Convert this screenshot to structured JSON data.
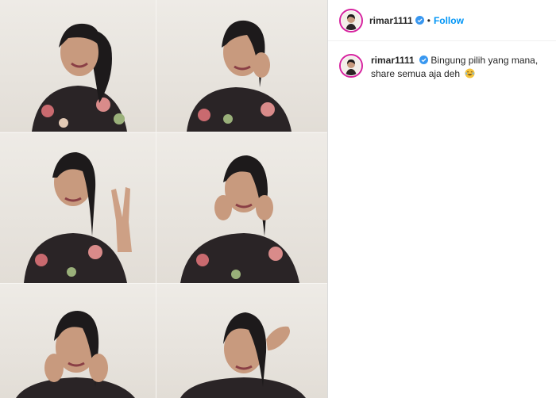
{
  "post": {
    "username": "rimar1111",
    "separator": "•",
    "follow_label": "Follow",
    "caption_line1": "Bingung pilih yang mana,",
    "caption_line2": "share semua aja deh",
    "caption_emoji": "laughing-tears-emoji"
  },
  "colors": {
    "follow": "#0095f6",
    "verified": "#3897f0",
    "avatar_ring": "#d6249f"
  },
  "photos": [
    {
      "name": "photo-wink-smile"
    },
    {
      "name": "photo-hand-on-cheek-wink"
    },
    {
      "name": "photo-peace-sign"
    },
    {
      "name": "photo-both-hands-cheeks-wink"
    },
    {
      "name": "photo-hands-on-cheeks"
    },
    {
      "name": "photo-hand-on-forehead"
    }
  ]
}
